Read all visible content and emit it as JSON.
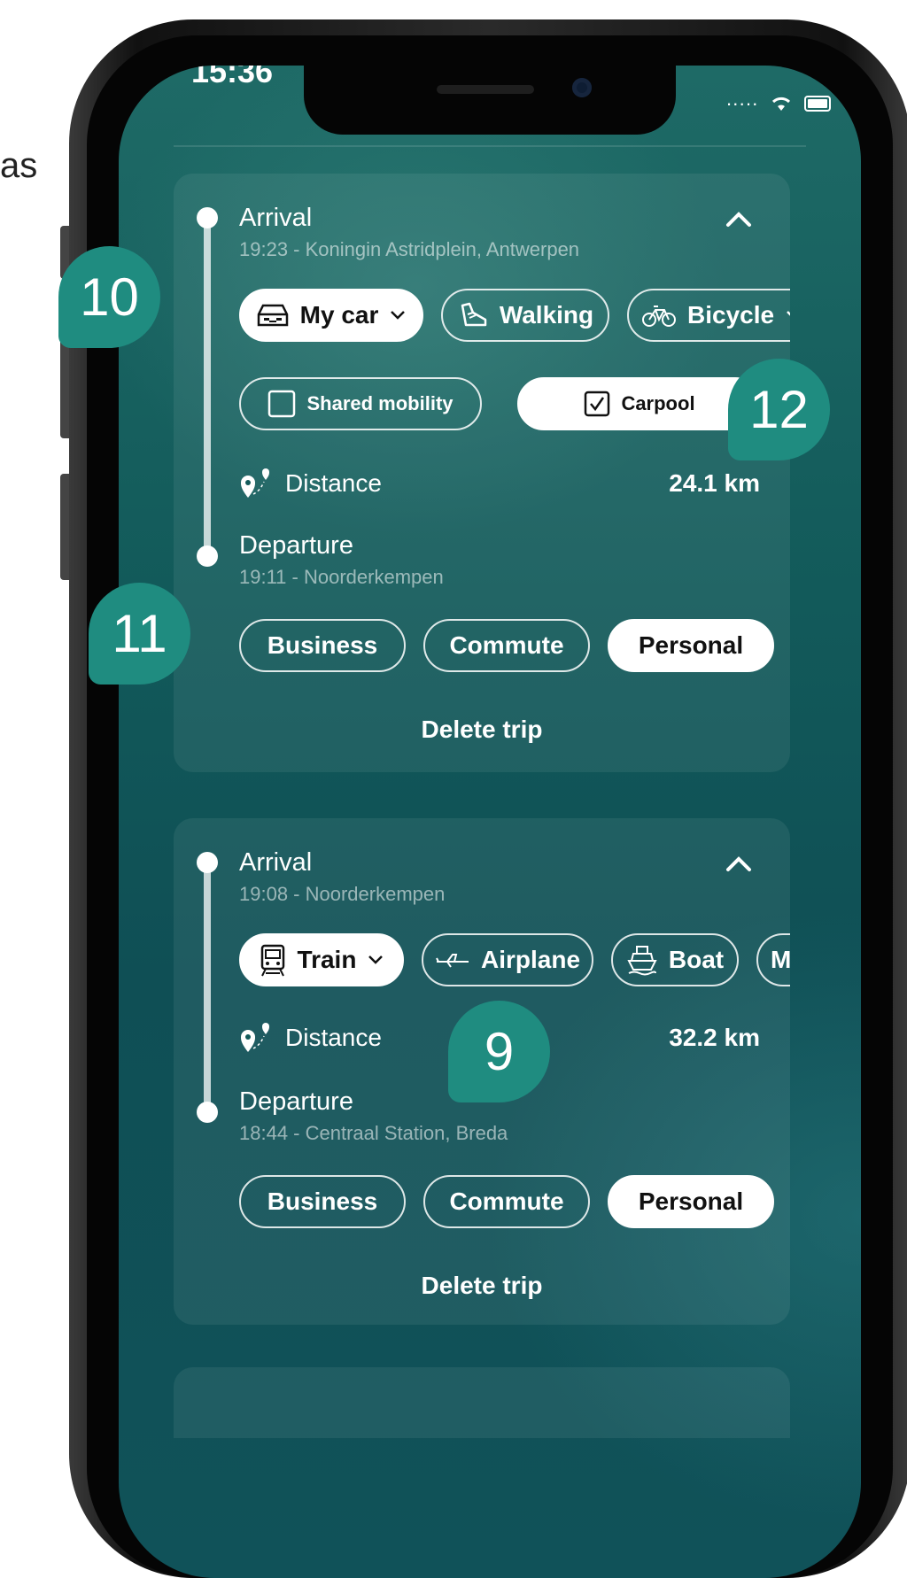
{
  "side_text": "as",
  "status": {
    "time": "15:36"
  },
  "colors": {
    "accent": "#1f8c80",
    "background": "#125a5a"
  },
  "trips": [
    {
      "arrival": {
        "label": "Arrival",
        "detail": "19:23 - Koningin Astridplein, Antwerpen"
      },
      "modes": [
        {
          "label": "My car",
          "icon": "car-icon",
          "selected": true,
          "dropdown": true
        },
        {
          "label": "Walking",
          "icon": "shoe-icon",
          "selected": false
        },
        {
          "label": "Bicycle",
          "icon": "bicycle-icon",
          "selected": false,
          "dropdown": true
        }
      ],
      "options": [
        {
          "label": "Shared mobility",
          "checked": false
        },
        {
          "label": "Carpool",
          "checked": true
        }
      ],
      "distance": {
        "label": "Distance",
        "value": "24.1 km"
      },
      "departure": {
        "label": "Departure",
        "detail": "19:11 -  Noorderkempen"
      },
      "purposes": [
        {
          "label": "Business",
          "selected": false
        },
        {
          "label": "Commute",
          "selected": false
        },
        {
          "label": "Personal",
          "selected": true
        }
      ],
      "delete_label": "Delete trip"
    },
    {
      "arrival": {
        "label": "Arrival",
        "detail": "19:08 - Noorderkempen"
      },
      "modes": [
        {
          "label": "Train",
          "icon": "train-icon",
          "selected": true,
          "dropdown": true
        },
        {
          "label": "Airplane",
          "icon": "airplane-icon",
          "selected": false
        },
        {
          "label": "Boat",
          "icon": "boat-icon",
          "selected": false
        },
        {
          "label": "M",
          "icon": "",
          "selected": false
        }
      ],
      "distance": {
        "label": "Distance",
        "value": "32.2 km"
      },
      "departure": {
        "label": "Departure",
        "detail": "18:44 -  Centraal Station, Breda"
      },
      "purposes": [
        {
          "label": "Business",
          "selected": false
        },
        {
          "label": "Commute",
          "selected": false
        },
        {
          "label": "Personal",
          "selected": true
        }
      ],
      "delete_label": "Delete trip"
    }
  ],
  "badges": [
    "10",
    "12",
    "11",
    "9"
  ]
}
